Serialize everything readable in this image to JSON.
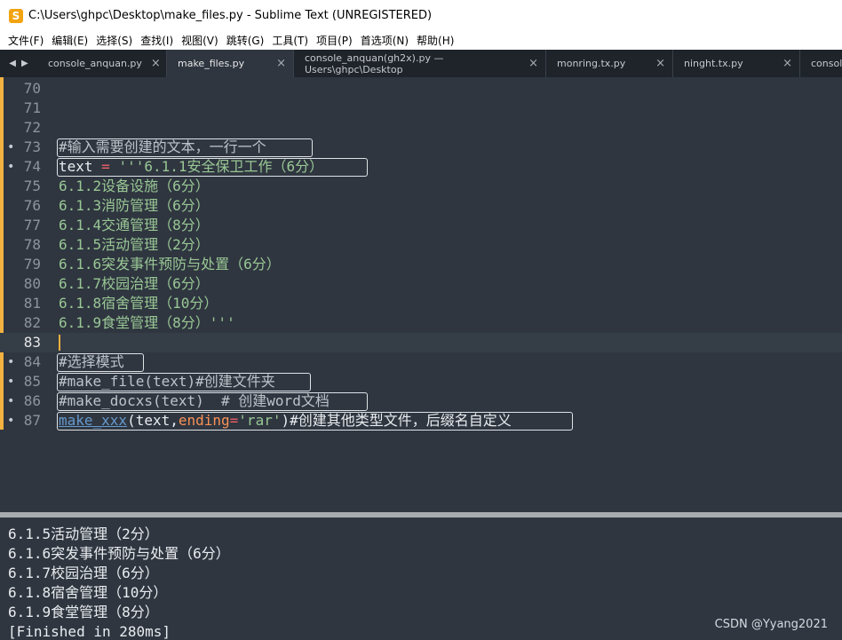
{
  "window": {
    "title": "C:\\Users\\ghpc\\Desktop\\make_files.py - Sublime Text (UNREGISTERED)",
    "icon": "sublime-icon"
  },
  "menu": [
    "文件(F)",
    "编辑(E)",
    "选择(S)",
    "查找(I)",
    "视图(V)",
    "跳转(G)",
    "工具(T)",
    "项目(P)",
    "首选项(N)",
    "帮助(H)"
  ],
  "tabs": [
    {
      "label": "console_anquan.py",
      "active": false,
      "close": "×"
    },
    {
      "label": "make_files.py",
      "active": true,
      "close": "×"
    },
    {
      "label": "console_anquan(gh2x).py — Users\\ghpc\\Desktop",
      "active": false,
      "close": "×"
    },
    {
      "label": "monring.tx.py",
      "active": false,
      "close": "×"
    },
    {
      "label": "ninght.tx.py",
      "active": false,
      "close": "×"
    },
    {
      "label": "console",
      "active": false,
      "close": ""
    }
  ],
  "editor": {
    "lines": [
      {
        "num": "70",
        "text": ""
      },
      {
        "num": "71",
        "text": ""
      },
      {
        "num": "72",
        "text": ""
      },
      {
        "num": "73",
        "text": "#输入需要创建的文本，一行一个"
      },
      {
        "num": "74",
        "t1": "text",
        "t2": " = ",
        "t3": "'''6.1.1安全保卫工作（6分）"
      },
      {
        "num": "75",
        "text": "6.1.2设备设施（6分）"
      },
      {
        "num": "76",
        "text": "6.1.3消防管理（6分）"
      },
      {
        "num": "77",
        "text": "6.1.4交通管理（8分）"
      },
      {
        "num": "78",
        "text": "6.1.5活动管理（2分）"
      },
      {
        "num": "79",
        "text": "6.1.6突发事件预防与处置（6分）"
      },
      {
        "num": "80",
        "text": "6.1.7校园治理（6分）"
      },
      {
        "num": "81",
        "text": "6.1.8宿舍管理（10分）"
      },
      {
        "num": "82",
        "text": "6.1.9食堂管理（8分）'''"
      },
      {
        "num": "83",
        "text": ""
      },
      {
        "num": "84",
        "text": "#选择模式"
      },
      {
        "num": "85",
        "text": "#make_file(text)#创建文件夹"
      },
      {
        "num": "86",
        "text": "#make_docxs(text)  # 创建word文档"
      },
      {
        "num": "87",
        "f": "make_xxx",
        "p1": "(text,",
        "k": "ending",
        "eq": "=",
        "s": "'rar'",
        "p2": ")#创建其他类型文件，后缀名自定义"
      }
    ]
  },
  "output": {
    "lines": [
      "6.1.5活动管理（2分）",
      "6.1.6突发事件预防与处置（6分）",
      "6.1.7校园治理（6分）",
      "6.1.8宿舍管理（10分）",
      "6.1.9食堂管理（8分）",
      "[Finished in 280ms]"
    ],
    "watermark": "CSDN @Yyang2021"
  }
}
